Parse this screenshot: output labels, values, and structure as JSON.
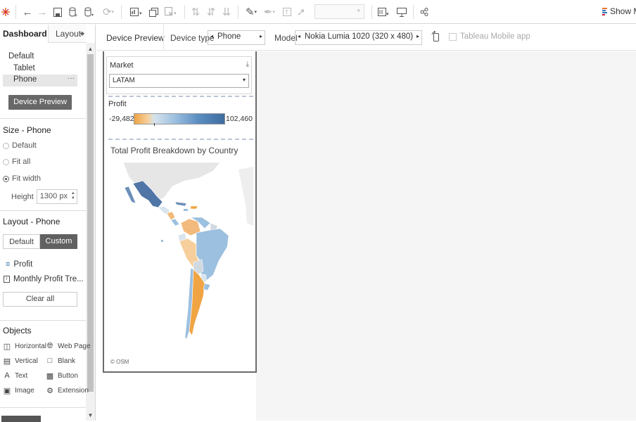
{
  "toolbar": {
    "show_me_label": "Show Me"
  },
  "left_pane": {
    "tabs": {
      "dashboard": "Dashboard",
      "layout": "Layout"
    },
    "devices": [
      "Default",
      "Tablet",
      "Phone"
    ],
    "device_preview_button": "Device Preview",
    "size_section": {
      "title": "Size - Phone",
      "options": [
        "Default",
        "Fit all",
        "Fit width"
      ],
      "selected": "Fit width",
      "height_label": "Height",
      "height_value": "1300 px"
    },
    "layout_section": {
      "title": "Layout - Phone",
      "default_label": "Default",
      "custom_label": "Custom",
      "items": [
        "Profit",
        "Monthly Profit Tre..."
      ],
      "clear_all": "Clear all"
    },
    "objects_section": {
      "title": "Objects",
      "items": [
        "Horizontal",
        "Web Page",
        "Vertical",
        "Blank",
        "Text",
        "Button",
        "Image",
        "Extension"
      ]
    }
  },
  "device_bar": {
    "preview_label": "Device Preview",
    "device_type_label": "Device type",
    "device_type_value": "Phone",
    "model_label": "Model",
    "model_value": "Nokia Lumia 1020 (320 x 480)",
    "mobile_app_label": "Tableau Mobile app"
  },
  "phone_view": {
    "market": {
      "title": "Market",
      "value": "LATAM"
    },
    "legend": {
      "title": "Profit",
      "min": "-29,482",
      "max": "102,460"
    },
    "map": {
      "title": "Total Profit Breakdown by Country",
      "attribution": "© OSM"
    }
  },
  "colors": {
    "positive_high": "#3e6c9f",
    "positive_mid": "#9cc0df",
    "negative": "#f0a443",
    "accent": "#3a72b6"
  }
}
